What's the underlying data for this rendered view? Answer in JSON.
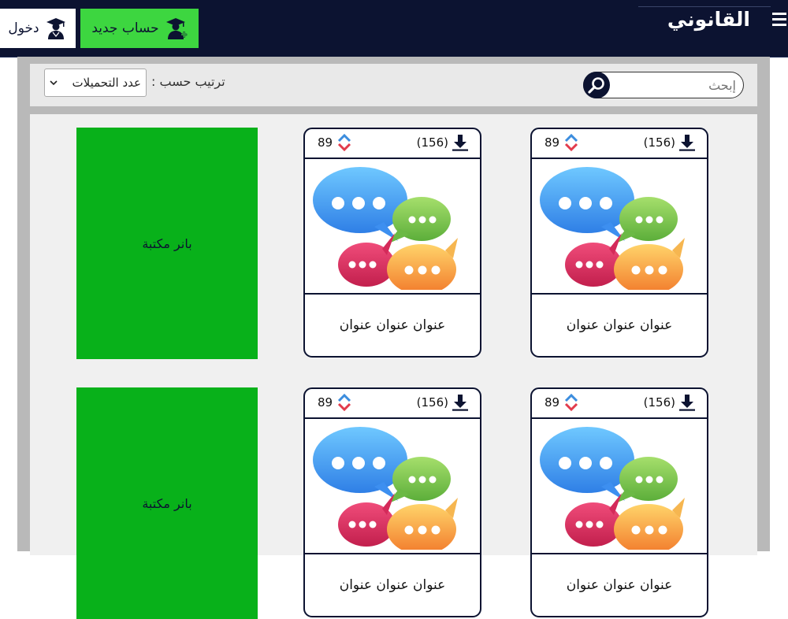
{
  "header": {
    "brand": "القانوني",
    "login_label": "دخول",
    "new_account_label": "حساب جديد"
  },
  "toolbar": {
    "search_placeholder": "إبحث",
    "sort_label": "ترتيب حسب :",
    "sort_selected": "عدد التحميلات"
  },
  "cards": [
    {
      "downloads": "(156)",
      "rating": "89",
      "title": "عنوان عنوان عنوان"
    },
    {
      "downloads": "(156)",
      "rating": "89",
      "title": "عنوان عنوان عنوان"
    },
    {
      "downloads": "(156)",
      "rating": "89",
      "title": "عنوان عنوان عنوان"
    },
    {
      "downloads": "(156)",
      "rating": "89",
      "title": "عنوان عنوان عنوان"
    }
  ],
  "banners": [
    {
      "label": "بانر مكتبة"
    },
    {
      "label": "بانر مكتبة"
    }
  ],
  "colors": {
    "header_bg": "#0c1331",
    "accent_green": "#3dd640",
    "banner_green": "#08b11a"
  },
  "icons": {
    "menu": "menu-icon",
    "login": "graduate-user-icon",
    "new_account": "graduate-add-user-icon",
    "search": "search-icon",
    "download": "download-icon",
    "rating": "rating-arrows-icon",
    "card_image": "chat-bubbles-icon"
  }
}
